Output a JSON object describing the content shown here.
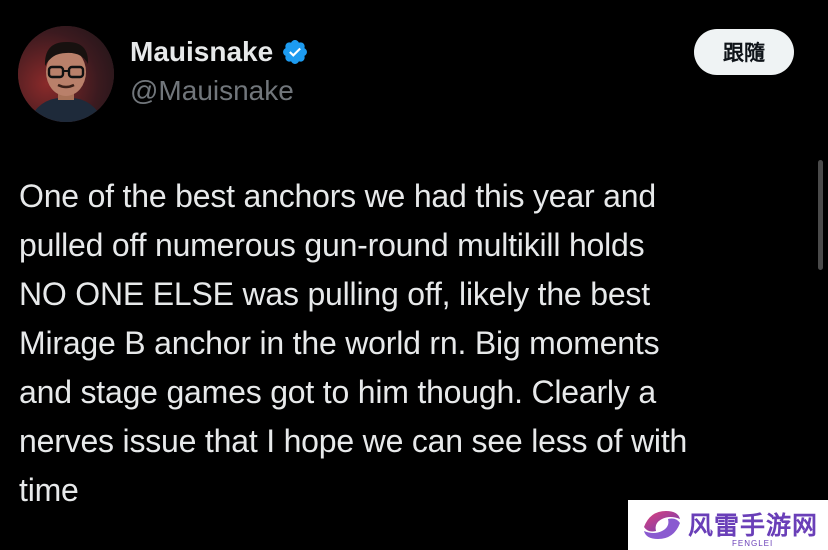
{
  "author": {
    "display_name": "Mauisnake",
    "handle": "@Mauisnake",
    "avatar_icon": "person-avatar",
    "verified_icon": "verified-badge-icon",
    "verified_color": "#1d9bf0"
  },
  "follow_button": {
    "label": "跟隨"
  },
  "tweet": {
    "text": "One of the best anchors we had this year and\npulled off numerous gun-round multikill holds\nNO ONE ELSE was pulling off, likely the best\nMirage B anchor in the world rn. Big moments\nand stage games got to him though. Clearly a\nnerves issue that I hope we can see less of with\ntime"
  },
  "watermark": {
    "name_cn": "风雷手游网",
    "name_en": "FENGLEI",
    "logo_icon": "fenglei-logo-icon",
    "color": "#6a3fb8"
  },
  "colors": {
    "background": "#000000",
    "text_primary": "#e7e9ea",
    "text_secondary": "#71767b",
    "button_bg": "#eff3f4"
  }
}
